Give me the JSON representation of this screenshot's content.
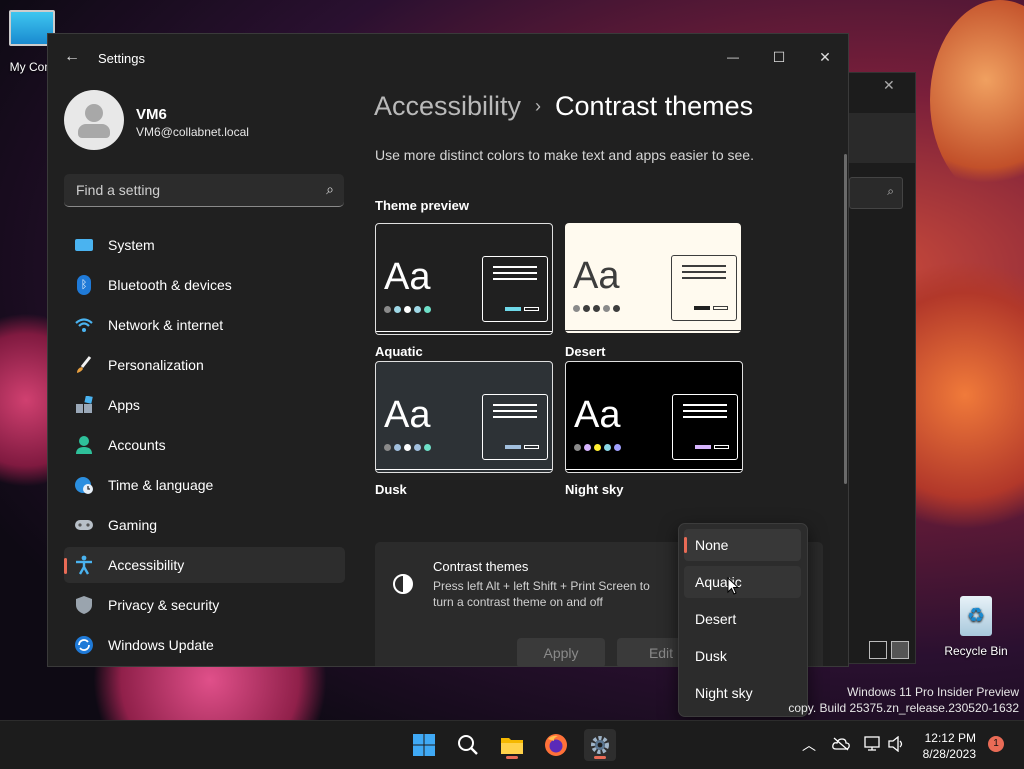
{
  "desktop": {
    "icons": [
      {
        "label": "My Com"
      },
      {
        "label": "Recycle Bin"
      }
    ],
    "watermark": {
      "line1": "Windows 11 Pro Insider Preview",
      "line2": "copy. Build 25375.zn_release.230520-1632"
    }
  },
  "window": {
    "title": "Settings",
    "controls": {
      "minimize": "—",
      "maximize": "☐",
      "close": "✕"
    }
  },
  "user": {
    "name": "VM6",
    "email": "VM6@collabnet.local"
  },
  "search": {
    "placeholder": "Find a setting"
  },
  "sidebar": {
    "items": [
      {
        "label": "System",
        "icon": "monitor-icon"
      },
      {
        "label": "Bluetooth & devices",
        "icon": "bluetooth-icon"
      },
      {
        "label": "Network & internet",
        "icon": "wifi-icon"
      },
      {
        "label": "Personalization",
        "icon": "brush-icon"
      },
      {
        "label": "Apps",
        "icon": "apps-icon"
      },
      {
        "label": "Accounts",
        "icon": "person-icon"
      },
      {
        "label": "Time & language",
        "icon": "globe-clock-icon"
      },
      {
        "label": "Gaming",
        "icon": "gamepad-icon"
      },
      {
        "label": "Accessibility",
        "icon": "accessibility-icon",
        "active": true
      },
      {
        "label": "Privacy & security",
        "icon": "shield-icon"
      },
      {
        "label": "Windows Update",
        "icon": "update-icon"
      }
    ]
  },
  "main": {
    "breadcrumb": {
      "parent": "Accessibility",
      "separator": "›",
      "current": "Contrast themes"
    },
    "subtitle": "Use more distinct colors to make text and apps easier to see.",
    "preview_heading": "Theme preview",
    "themes": [
      {
        "name": "Aquatic",
        "sample": "Aa",
        "bg": "#202020",
        "fg": "#ffffff",
        "dots": [
          "#8a8a8a",
          "#9fd8e6",
          "#ffffff",
          "#9fd8e6",
          "#6ee0c8"
        ],
        "accent": "#6ed8e8"
      },
      {
        "name": "Desert",
        "sample": "Aa",
        "bg": "#fffaef",
        "fg": "#3d3d3d",
        "dots": [
          "#8a8a8a",
          "#3d3d3d",
          "#3d3d3d",
          "#8a8a8a",
          "#3d3d3d"
        ],
        "accent": "#202020"
      },
      {
        "name": "Dusk",
        "sample": "Aa",
        "bg": "#2d3236",
        "fg": "#ffffff",
        "dots": [
          "#8a8a8a",
          "#a1bfde",
          "#ffffff",
          "#a1bfde",
          "#6ee0c8"
        ],
        "accent": "#a1bfde"
      },
      {
        "name": "Night sky",
        "sample": "Aa",
        "bg": "#000000",
        "fg": "#ffffff",
        "dots": [
          "#8a8a8a",
          "#d6b4fd",
          "#ffee32",
          "#8ad7e6",
          "#a1a1ff"
        ],
        "accent": "#d6b4fd"
      }
    ],
    "contrast_card": {
      "title": "Contrast themes",
      "description": "Press left Alt + left Shift + Print Screen to turn a contrast theme on and off",
      "apply_label": "Apply",
      "edit_label": "Edit"
    }
  },
  "dropdown": {
    "options": [
      "None",
      "Aquatic",
      "Desert",
      "Dusk",
      "Night sky"
    ],
    "selected": "None",
    "hovered": "Aquatic"
  },
  "taskbar": {
    "apps": [
      "start-icon",
      "search-icon",
      "file-explorer-icon",
      "firefox-icon",
      "settings-icon"
    ],
    "clock": {
      "time": "12:12 PM",
      "date": "8/28/2023"
    },
    "notification_count": "1"
  }
}
